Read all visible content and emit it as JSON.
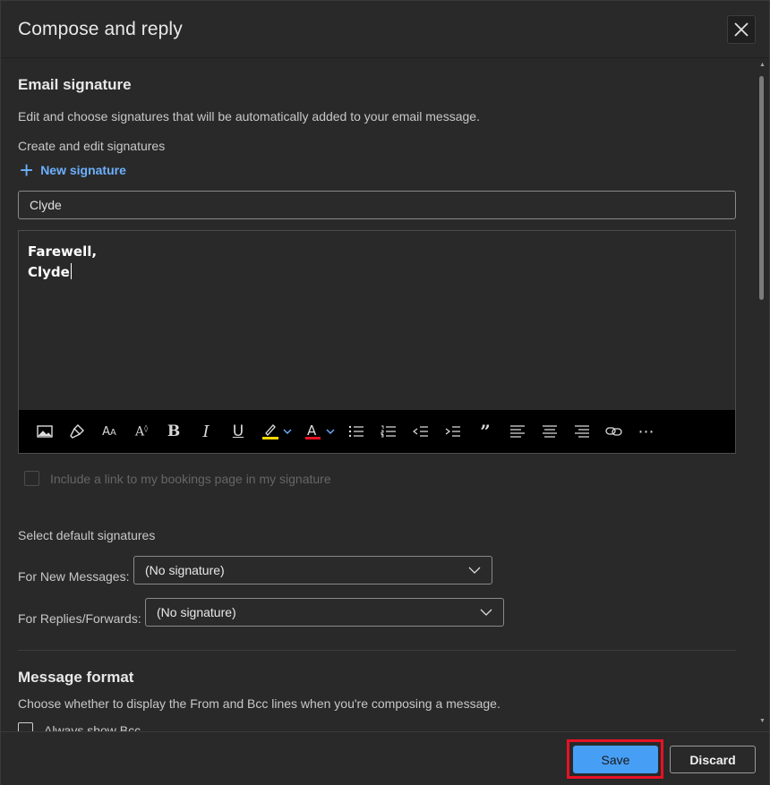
{
  "dialog": {
    "title": "Compose and reply",
    "close_icon": "close-icon"
  },
  "signature": {
    "heading": "Email signature",
    "description": "Edit and choose signatures that will be automatically added to your email message.",
    "create_label": "Create and edit signatures",
    "new_signature_label": "New signature",
    "name_value": "Clyde",
    "body_line1": "Farewell,",
    "body_line2": "Clyde",
    "toolbar": [
      {
        "name": "insert-image-icon"
      },
      {
        "name": "format-painter-icon"
      },
      {
        "name": "font-size-icon"
      },
      {
        "name": "superscript-icon"
      },
      {
        "name": "bold-icon"
      },
      {
        "name": "italic-icon"
      },
      {
        "name": "underline-icon"
      },
      {
        "name": "highlight-icon"
      },
      {
        "name": "font-color-icon"
      },
      {
        "name": "bullets-icon"
      },
      {
        "name": "numbering-icon"
      },
      {
        "name": "decrease-indent-icon"
      },
      {
        "name": "increase-indent-icon"
      },
      {
        "name": "quote-icon"
      },
      {
        "name": "align-left-icon"
      },
      {
        "name": "align-center-icon"
      },
      {
        "name": "align-right-icon"
      },
      {
        "name": "link-icon"
      },
      {
        "name": "more-options-icon"
      }
    ],
    "bookings_label": "Include a link to my bookings page in my signature"
  },
  "defaults": {
    "heading": "Select default signatures",
    "new_messages_label": "For New Messages:",
    "new_messages_value": "(No signature)",
    "replies_label": "For Replies/Forwards:",
    "replies_value": "(No signature)"
  },
  "message_format": {
    "heading": "Message format",
    "description": "Choose whether to display the From and Bcc lines when you're composing a message.",
    "always_bcc_label": "Always show Bcc"
  },
  "footer": {
    "save_label": "Save",
    "discard_label": "Discard"
  },
  "colors": {
    "accent": "#479ef5",
    "link": "#6cb0ff",
    "highlight_border": "#e81123",
    "highlight_swatch": "#ffd800",
    "font_color_swatch": "#e81123"
  }
}
